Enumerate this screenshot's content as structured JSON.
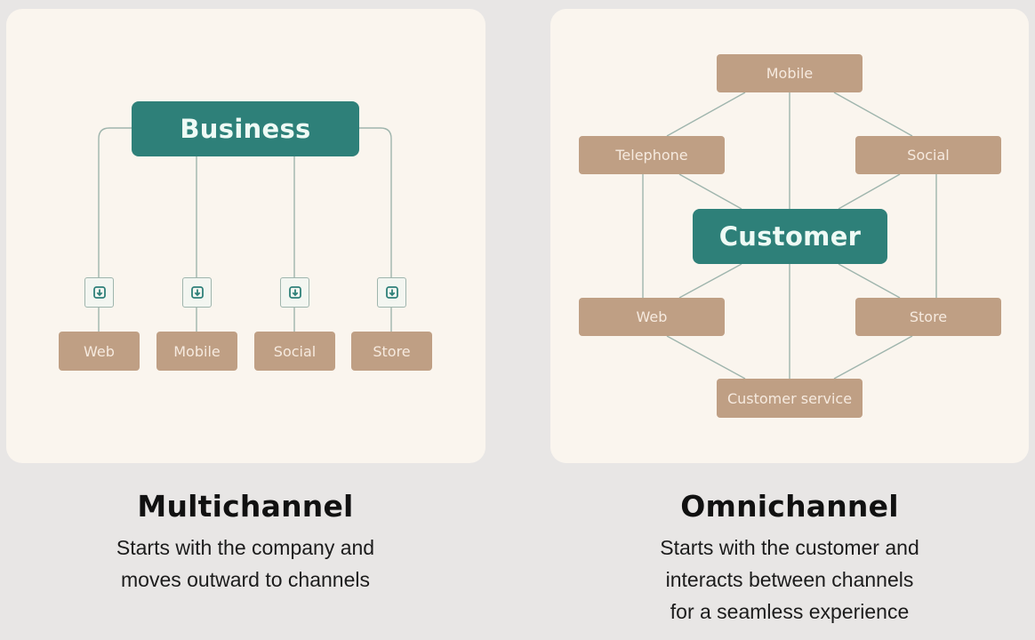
{
  "colors": {
    "page_background": "#e8e6e5",
    "panel_background": "#faf5ee",
    "hub_fill": "#2e8079",
    "hub_text": "#eefaf5",
    "node_fill": "#bf9f84",
    "node_text": "#f6eadf",
    "connector": "#9fb5ad"
  },
  "multichannel": {
    "hub_label": "Business",
    "channels": [
      {
        "label": "Web",
        "icon": "download-arrow-icon"
      },
      {
        "label": "Mobile",
        "icon": "download-arrow-icon"
      },
      {
        "label": "Social",
        "icon": "download-arrow-icon"
      },
      {
        "label": "Store",
        "icon": "download-arrow-icon"
      }
    ],
    "title": "Multichannel",
    "description_lines": [
      "Starts with the company and",
      "moves outward to channels"
    ]
  },
  "omnichannel": {
    "hub_label": "Customer",
    "channels": {
      "top": "Mobile",
      "upper_left": "Telephone",
      "upper_right": "Social",
      "lower_left": "Web",
      "lower_right": "Store",
      "bottom": "Customer service"
    },
    "title": "Omnichannel",
    "description_lines": [
      "Starts with the customer and",
      "interacts between channels",
      "for a seamless experience"
    ]
  }
}
